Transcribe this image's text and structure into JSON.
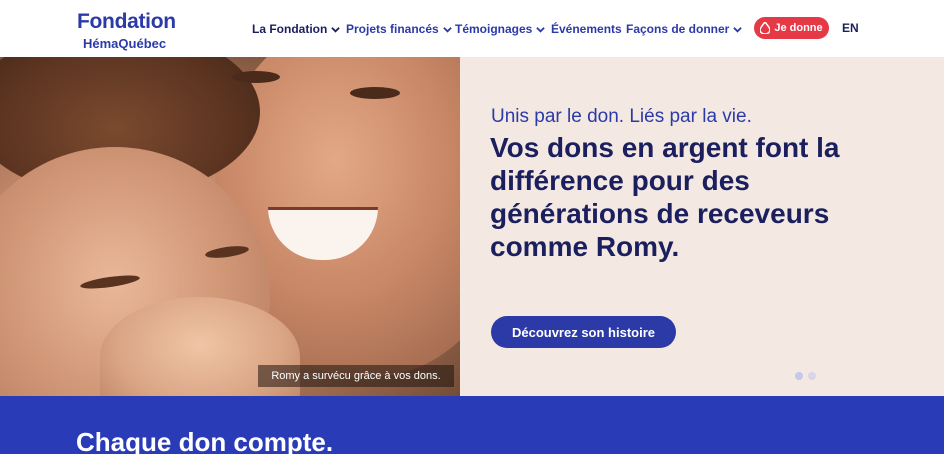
{
  "header": {
    "logo": {
      "line1": "Fondation",
      "line2": "HémaQuébec"
    },
    "nav": [
      {
        "label": "La Fondation"
      },
      {
        "label": "Projets financés"
      },
      {
        "label": "Témoignages"
      },
      {
        "label": "Événements"
      },
      {
        "label": "Façons de donner"
      }
    ],
    "donate_label": "Je donne",
    "lang_label": "EN"
  },
  "hero": {
    "tagline": "Unis par le don. Liés par la vie.",
    "headline": "Vos dons en argent font la différence pour des générations de receveurs comme Romy.",
    "cta_label": "Découvrez son histoire",
    "caption": "Romy a survécu grâce à vos dons.",
    "carousel": {
      "slides": 2,
      "active": 1
    }
  },
  "section": {
    "title": "Chaque don compte."
  },
  "colors": {
    "brand_blue": "#2c3aa8",
    "navy": "#1b1f5e",
    "donate_red": "#e63946",
    "hero_bg": "#f3e9e2",
    "band_blue": "#2a3bb7"
  },
  "icons": {
    "nav_dropdown": "chevron-down-icon",
    "donate": "blood-drop-icon"
  }
}
